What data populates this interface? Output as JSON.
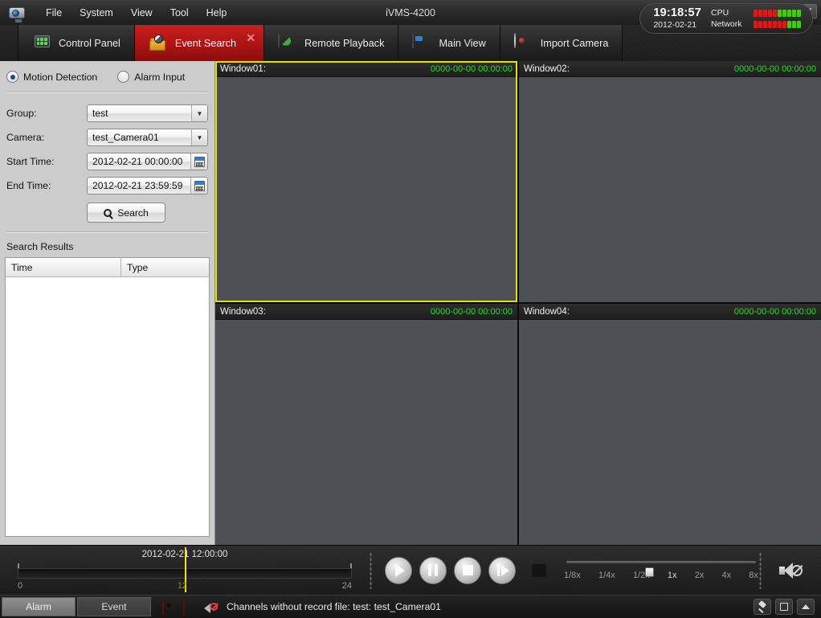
{
  "window": {
    "title": "iVMS-4200",
    "controls": {
      "lock": "lock-icon",
      "minimize": "—",
      "maximize": "▫",
      "close": "✕"
    }
  },
  "menubar": {
    "items": [
      {
        "label": "File"
      },
      {
        "label": "System"
      },
      {
        "label": "View"
      },
      {
        "label": "Tool"
      },
      {
        "label": "Help"
      }
    ]
  },
  "tabs": [
    {
      "label": "Control Panel",
      "icon": "control-panel-icon",
      "active": false
    },
    {
      "label": "Event Search",
      "icon": "event-search-folder-icon",
      "active": true,
      "close": "✕"
    },
    {
      "label": "Remote Playback",
      "icon": "remote-playback-clock-icon",
      "active": false
    },
    {
      "label": "Main View",
      "icon": "main-view-monitor-icon",
      "active": false
    },
    {
      "label": "Import Camera",
      "icon": "import-camera-dome-icon",
      "active": false
    }
  ],
  "status_widget": {
    "time": "19:18:57",
    "date": "2012-02-21",
    "cpu_label": "CPU",
    "network_label": "Network",
    "cpu_segments": 10,
    "cpu_red": 5,
    "network_segments": 10,
    "network_red": 7,
    "color_red": "#d41d1d",
    "color_green": "#4cc421"
  },
  "sidebar": {
    "search_type": {
      "motion_label": "Motion Detection",
      "motion_selected": true,
      "alarm_label": "Alarm Input",
      "alarm_selected": false
    },
    "fields": [
      {
        "label": "Group:",
        "value": "test",
        "kind": "select"
      },
      {
        "label": "Camera:",
        "value": "test_Camera01",
        "kind": "select"
      },
      {
        "label": "Start Time:",
        "value": "2012-02-21 00:00:00",
        "kind": "datetime"
      },
      {
        "label": "End Time:",
        "value": "2012-02-21 23:59:59",
        "kind": "datetime"
      }
    ],
    "search_button": "Search",
    "results_title": "Search Results",
    "results_columns": [
      "Time",
      "Type"
    ],
    "results_rows": []
  },
  "video_windows": [
    {
      "name": "Window01:",
      "time": "0000-00-00 00:00:00",
      "selected": true
    },
    {
      "name": "Window02:",
      "time": "0000-00-00 00:00:00",
      "selected": false
    },
    {
      "name": "Window03:",
      "time": "0000-00-00 00:00:00",
      "selected": false
    },
    {
      "name": "Window04:",
      "time": "0000-00-00 00:00:00",
      "selected": false
    }
  ],
  "playback": {
    "timeline_label": "2012-02-21 12:00:00",
    "tick_start": "0",
    "tick_mid": "12",
    "tick_end": "24",
    "cursor_percent": 50,
    "buttons": [
      {
        "name": "play",
        "glyph": "play-icon"
      },
      {
        "name": "pause",
        "glyph": "pause-icon"
      },
      {
        "name": "stop",
        "glyph": "stop-icon"
      },
      {
        "name": "single-frame",
        "glyph": "single-frame-icon"
      }
    ],
    "fullscreen": "fullscreen-icon",
    "speeds": [
      "1/8x",
      "1/4x",
      "1/2x",
      "1x",
      "2x",
      "4x",
      "8x"
    ],
    "current_speed": "1x",
    "audio": "mute-icon"
  },
  "statusbar": {
    "tabs": [
      {
        "label": "Alarm",
        "active": true
      },
      {
        "label": "Event",
        "active": false
      }
    ],
    "icons": [
      "motion-detection-icon",
      "alarm-lamp-icon",
      "audio-muted-icon"
    ],
    "message": "Channels without record file: test: test_Camera01",
    "right_buttons": [
      "pin-icon",
      "maximize-panel-icon",
      "collapse-icon"
    ]
  }
}
